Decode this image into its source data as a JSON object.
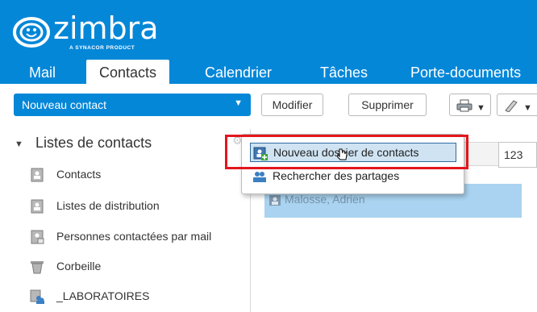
{
  "app": {
    "logo_text": "zimbra",
    "logo_subtitle": "A SYNACOR PRODUCT",
    "brand_color": "#0587d8"
  },
  "tabs": [
    {
      "label": "Mail",
      "active": false
    },
    {
      "label": "Contacts",
      "active": true
    },
    {
      "label": "Calendrier",
      "active": false
    },
    {
      "label": "Tâches",
      "active": false
    },
    {
      "label": "Porte-documents",
      "active": false
    }
  ],
  "toolbar": {
    "new_contact_label": "Nouveau contact",
    "edit_label": "Modifier",
    "delete_label": "Supprimer",
    "print_icon": "print-icon",
    "tag_icon": "tag-icon"
  },
  "sidebar": {
    "section_title": "Listes de contacts",
    "items": [
      {
        "label": "Contacts",
        "icon": "address-book-icon"
      },
      {
        "label": "Listes de distribution",
        "icon": "address-book-icon"
      },
      {
        "label": "Personnes contactées par mail",
        "icon": "address-book-mail-icon"
      },
      {
        "label": "Corbeille",
        "icon": "trash-icon"
      },
      {
        "label": "_LABORATOIRES",
        "icon": "shared-folder-icon"
      }
    ]
  },
  "list": {
    "alpha_filter": "123",
    "selected_contact": "Malosse, Adrien"
  },
  "context_menu": {
    "items": [
      {
        "label": "Nouveau dossier de contacts",
        "icon": "new-folder-icon",
        "highlighted": true
      },
      {
        "label": "Rechercher des partages",
        "icon": "find-shares-icon",
        "highlighted": false
      }
    ]
  },
  "colors": {
    "selection": "#a9d3f0",
    "highlight_box": "#e3161c"
  }
}
